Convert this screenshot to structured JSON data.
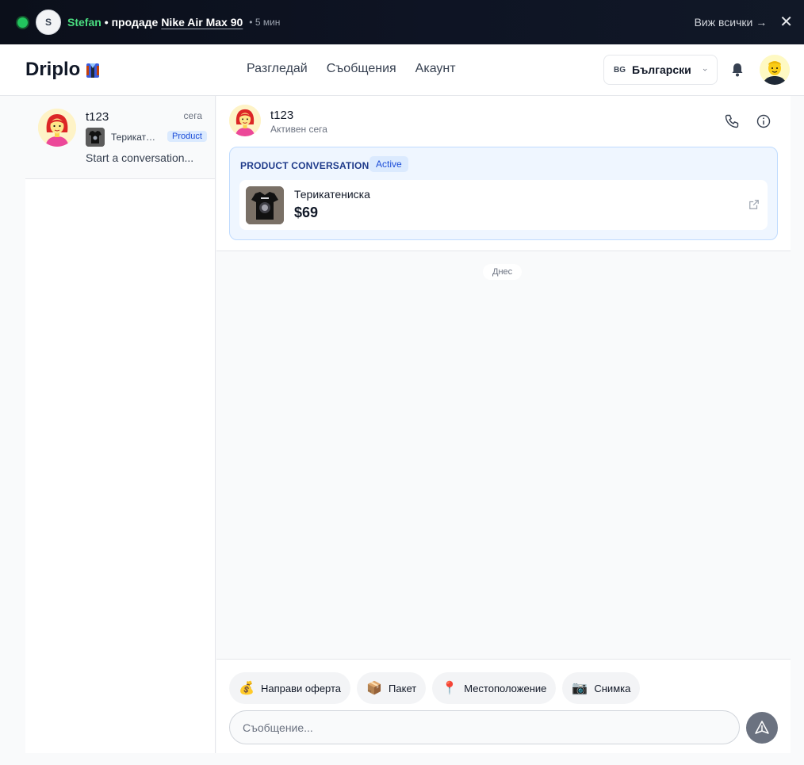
{
  "banner": {
    "avatar_letter": "S",
    "user": "Stefan",
    "action": "• продаде",
    "product": "Nike Air Max 90",
    "time": "• 5 мин",
    "view_all": "Виж всички →",
    "close": "✕"
  },
  "header": {
    "logo": "Driplo",
    "nav": [
      "Разгледай",
      "Съобщения",
      "Акаунт"
    ],
    "lang_code": "BG",
    "lang_label": "Български"
  },
  "sidebar": {
    "conversations": [
      {
        "name": "t123",
        "time": "сега",
        "product": "Терикатениска",
        "badge": "Product",
        "preview": "Start a conversation..."
      }
    ]
  },
  "chat": {
    "name": "t123",
    "status": "Активен сега",
    "product_conversation": {
      "title": "PRODUCT CONVERSATION",
      "status": "Active",
      "product_name": "Терикатениска",
      "price": "$69"
    },
    "date_divider": "Днес",
    "actions": [
      {
        "icon": "money-bag-icon",
        "glyph": "💰",
        "label": "Направи оферта"
      },
      {
        "icon": "package-icon",
        "glyph": "📦",
        "label": "Пакет"
      },
      {
        "icon": "location-pin-icon",
        "glyph": "📍",
        "label": "Местоположение"
      },
      {
        "icon": "camera-icon",
        "glyph": "📷",
        "label": "Снимка"
      }
    ],
    "input_placeholder": "Съобщение..."
  },
  "colors": {
    "accent_green": "#4ade80",
    "badge_blue": "#1d4ed8",
    "panel_blue": "#eff6ff"
  }
}
